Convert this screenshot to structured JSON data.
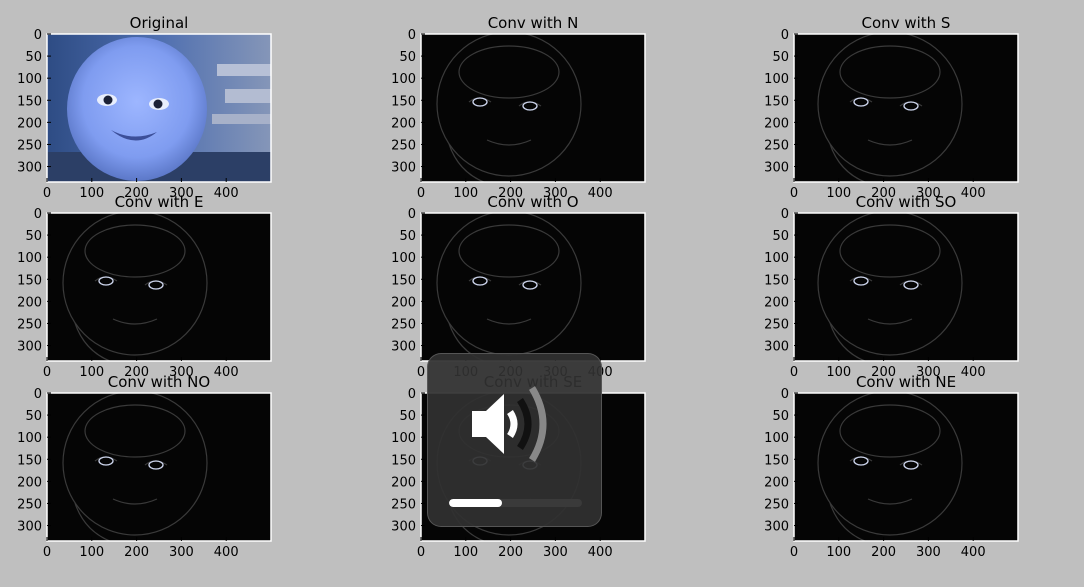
{
  "window": {
    "background": "#bfbfbf"
  },
  "chart_data": [
    {
      "type": "image",
      "title": "Original",
      "xlim": [
        0,
        500
      ],
      "ylim": [
        335,
        0
      ],
      "xticks": [
        0,
        100,
        200,
        300,
        400
      ],
      "yticks": [
        0,
        50,
        100,
        150,
        200,
        250,
        300
      ],
      "content": "baby-photo-blue"
    },
    {
      "type": "image",
      "title": "Conv with N",
      "xlim": [
        0,
        500
      ],
      "ylim": [
        335,
        0
      ],
      "xticks": [
        0,
        100,
        200,
        300,
        400
      ],
      "yticks": [
        0,
        50,
        100,
        150,
        200,
        250,
        300
      ],
      "content": "edge-map"
    },
    {
      "type": "image",
      "title": "Conv with S",
      "xlim": [
        0,
        500
      ],
      "ylim": [
        335,
        0
      ],
      "xticks": [
        0,
        100,
        200,
        300,
        400
      ],
      "yticks": [
        0,
        50,
        100,
        150,
        200,
        250,
        300
      ],
      "content": "edge-map"
    },
    {
      "type": "image",
      "title": "Conv with E",
      "xlim": [
        0,
        500
      ],
      "ylim": [
        335,
        0
      ],
      "xticks": [
        0,
        100,
        200,
        300,
        400
      ],
      "yticks": [
        0,
        50,
        100,
        150,
        200,
        250,
        300
      ],
      "content": "edge-map"
    },
    {
      "type": "image",
      "title": "Conv with O",
      "xlim": [
        0,
        500
      ],
      "ylim": [
        335,
        0
      ],
      "xticks": [
        0,
        100,
        200,
        300,
        400
      ],
      "yticks": [
        0,
        50,
        100,
        150,
        200,
        250,
        300
      ],
      "content": "edge-map"
    },
    {
      "type": "image",
      "title": "Conv with SO",
      "xlim": [
        0,
        500
      ],
      "ylim": [
        335,
        0
      ],
      "xticks": [
        0,
        100,
        200,
        300,
        400
      ],
      "yticks": [
        0,
        50,
        100,
        150,
        200,
        250,
        300
      ],
      "content": "edge-map"
    },
    {
      "type": "image",
      "title": "Conv with NO",
      "xlim": [
        0,
        500
      ],
      "ylim": [
        335,
        0
      ],
      "xticks": [
        0,
        100,
        200,
        300,
        400
      ],
      "yticks": [
        0,
        50,
        100,
        150,
        200,
        250,
        300
      ],
      "content": "edge-map"
    },
    {
      "type": "image",
      "title": "Conv with SE",
      "xlim": [
        0,
        500
      ],
      "ylim": [
        335,
        0
      ],
      "xticks": [
        0,
        100,
        200,
        300,
        400
      ],
      "yticks": [
        0,
        50,
        100,
        150,
        200,
        250,
        300
      ],
      "content": "edge-map"
    },
    {
      "type": "image",
      "title": "Conv with NE",
      "xlim": [
        0,
        500
      ],
      "ylim": [
        335,
        0
      ],
      "xticks": [
        0,
        100,
        200,
        300,
        400
      ],
      "yticks": [
        0,
        50,
        100,
        150,
        200,
        250,
        300
      ],
      "content": "edge-map"
    }
  ],
  "volume_osd": {
    "icon": "speaker-volume-icon",
    "level": 0.4
  }
}
